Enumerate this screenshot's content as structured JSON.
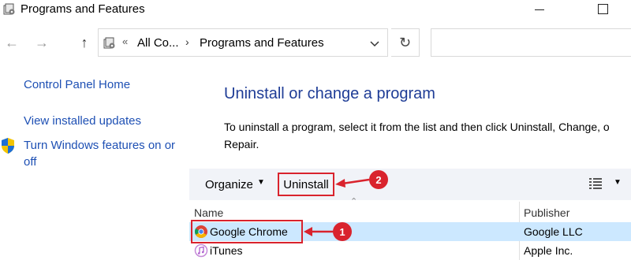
{
  "window": {
    "title": "Programs and Features"
  },
  "navigation": {
    "back_icon": "back-arrow-icon",
    "forward_icon": "forward-arrow-icon",
    "up_icon": "up-arrow-icon",
    "breadcrumb_overflow": "«",
    "breadcrumbs": [
      "All Co...",
      "Programs and Features"
    ],
    "refresh_icon": "refresh-icon"
  },
  "left_pane": {
    "links": [
      "Control Panel Home",
      "View installed updates",
      "Turn Windows features on or",
      "off"
    ]
  },
  "main": {
    "heading": "Uninstall or change a program",
    "description_line1": "To uninstall a program, select it from the list and then click Uninstall, Change, o",
    "description_line2": "Repair."
  },
  "toolbar": {
    "organize_label": "Organize",
    "uninstall_label": "Uninstall"
  },
  "list": {
    "columns": [
      "Name",
      "Publisher"
    ],
    "rows": [
      {
        "name": "Google Chrome",
        "publisher": "Google LLC",
        "selected": true
      },
      {
        "name": "iTunes",
        "publisher": "Apple Inc.",
        "selected": false
      }
    ]
  },
  "annotations": {
    "badge1": "1",
    "badge2": "2",
    "accent_color": "#d9232d"
  }
}
